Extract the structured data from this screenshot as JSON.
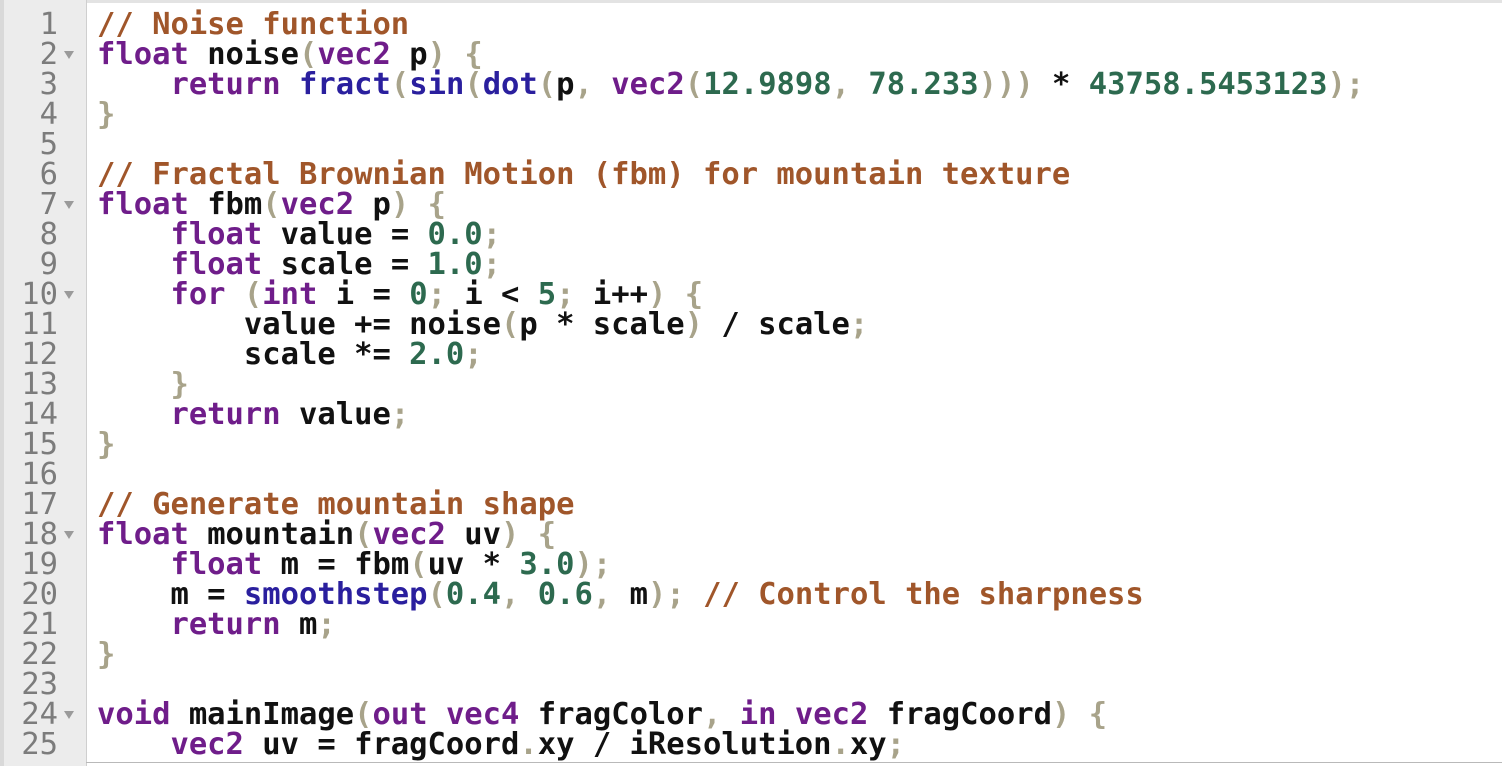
{
  "editor": {
    "language": "glsl",
    "lines": [
      {
        "n": "1",
        "fold": false,
        "tokens": [
          [
            "cm",
            "// Noise function"
          ]
        ]
      },
      {
        "n": "2",
        "fold": true,
        "tokens": [
          [
            "kw",
            "float"
          ],
          [
            "id",
            " noise"
          ],
          [
            "pu",
            "("
          ],
          [
            "kw",
            "vec2"
          ],
          [
            "id",
            " p"
          ],
          [
            "pu",
            ")"
          ],
          [
            "id",
            " "
          ],
          [
            "pu",
            "{"
          ]
        ]
      },
      {
        "n": "3",
        "fold": false,
        "tokens": [
          [
            "id",
            "    "
          ],
          [
            "kw",
            "return"
          ],
          [
            "id",
            " "
          ],
          [
            "fn",
            "fract"
          ],
          [
            "pu",
            "("
          ],
          [
            "fn",
            "sin"
          ],
          [
            "pu",
            "("
          ],
          [
            "fn",
            "dot"
          ],
          [
            "pu",
            "("
          ],
          [
            "id",
            "p"
          ],
          [
            "pu",
            ","
          ],
          [
            "id",
            " "
          ],
          [
            "kw",
            "vec2"
          ],
          [
            "pu",
            "("
          ],
          [
            "num",
            "12.9898"
          ],
          [
            "pu",
            ","
          ],
          [
            "id",
            " "
          ],
          [
            "num",
            "78.233"
          ],
          [
            "pu",
            ")))"
          ],
          [
            "id",
            " * "
          ],
          [
            "num",
            "43758.5453123"
          ],
          [
            "pu",
            ");"
          ]
        ]
      },
      {
        "n": "4",
        "fold": false,
        "tokens": [
          [
            "pu",
            "}"
          ]
        ]
      },
      {
        "n": "5",
        "fold": false,
        "tokens": []
      },
      {
        "n": "6",
        "fold": false,
        "tokens": [
          [
            "cm",
            "// Fractal Brownian Motion (fbm) for mountain texture"
          ]
        ]
      },
      {
        "n": "7",
        "fold": true,
        "tokens": [
          [
            "kw",
            "float"
          ],
          [
            "id",
            " fbm"
          ],
          [
            "pu",
            "("
          ],
          [
            "kw",
            "vec2"
          ],
          [
            "id",
            " p"
          ],
          [
            "pu",
            ")"
          ],
          [
            "id",
            " "
          ],
          [
            "pu",
            "{"
          ]
        ]
      },
      {
        "n": "8",
        "fold": false,
        "tokens": [
          [
            "id",
            "    "
          ],
          [
            "kw",
            "float"
          ],
          [
            "id",
            " value = "
          ],
          [
            "num",
            "0.0"
          ],
          [
            "pu",
            ";"
          ]
        ]
      },
      {
        "n": "9",
        "fold": false,
        "tokens": [
          [
            "id",
            "    "
          ],
          [
            "kw",
            "float"
          ],
          [
            "id",
            " scale = "
          ],
          [
            "num",
            "1.0"
          ],
          [
            "pu",
            ";"
          ]
        ]
      },
      {
        "n": "10",
        "fold": true,
        "tokens": [
          [
            "id",
            "    "
          ],
          [
            "kw",
            "for"
          ],
          [
            "id",
            " "
          ],
          [
            "pu",
            "("
          ],
          [
            "kw",
            "int"
          ],
          [
            "id",
            " i = "
          ],
          [
            "num",
            "0"
          ],
          [
            "pu",
            ";"
          ],
          [
            "id",
            " i < "
          ],
          [
            "num",
            "5"
          ],
          [
            "pu",
            ";"
          ],
          [
            "id",
            " i++"
          ],
          [
            "pu",
            ")"
          ],
          [
            "id",
            " "
          ],
          [
            "pu",
            "{"
          ]
        ]
      },
      {
        "n": "11",
        "fold": false,
        "tokens": [
          [
            "id",
            "        value += noise"
          ],
          [
            "pu",
            "("
          ],
          [
            "id",
            "p * scale"
          ],
          [
            "pu",
            ")"
          ],
          [
            "id",
            " / scale"
          ],
          [
            "pu",
            ";"
          ]
        ]
      },
      {
        "n": "12",
        "fold": false,
        "tokens": [
          [
            "id",
            "        scale *= "
          ],
          [
            "num",
            "2.0"
          ],
          [
            "pu",
            ";"
          ]
        ]
      },
      {
        "n": "13",
        "fold": false,
        "tokens": [
          [
            "id",
            "    "
          ],
          [
            "pu",
            "}"
          ]
        ]
      },
      {
        "n": "14",
        "fold": false,
        "tokens": [
          [
            "id",
            "    "
          ],
          [
            "kw",
            "return"
          ],
          [
            "id",
            " value"
          ],
          [
            "pu",
            ";"
          ]
        ]
      },
      {
        "n": "15",
        "fold": false,
        "tokens": [
          [
            "pu",
            "}"
          ]
        ]
      },
      {
        "n": "16",
        "fold": false,
        "tokens": []
      },
      {
        "n": "17",
        "fold": false,
        "tokens": [
          [
            "cm",
            "// Generate mountain shape"
          ]
        ]
      },
      {
        "n": "18",
        "fold": true,
        "tokens": [
          [
            "kw",
            "float"
          ],
          [
            "id",
            " mountain"
          ],
          [
            "pu",
            "("
          ],
          [
            "kw",
            "vec2"
          ],
          [
            "id",
            " uv"
          ],
          [
            "pu",
            ")"
          ],
          [
            "id",
            " "
          ],
          [
            "pu",
            "{"
          ]
        ]
      },
      {
        "n": "19",
        "fold": false,
        "tokens": [
          [
            "id",
            "    "
          ],
          [
            "kw",
            "float"
          ],
          [
            "id",
            " m = fbm"
          ],
          [
            "pu",
            "("
          ],
          [
            "id",
            "uv * "
          ],
          [
            "num",
            "3.0"
          ],
          [
            "pu",
            ");"
          ]
        ]
      },
      {
        "n": "20",
        "fold": false,
        "tokens": [
          [
            "id",
            "    m = "
          ],
          [
            "fn",
            "smoothstep"
          ],
          [
            "pu",
            "("
          ],
          [
            "num",
            "0.4"
          ],
          [
            "pu",
            ","
          ],
          [
            "id",
            " "
          ],
          [
            "num",
            "0.6"
          ],
          [
            "pu",
            ","
          ],
          [
            "id",
            " m"
          ],
          [
            "pu",
            ");"
          ],
          [
            "id",
            " "
          ],
          [
            "cm",
            "// Control the sharpness"
          ]
        ]
      },
      {
        "n": "21",
        "fold": false,
        "tokens": [
          [
            "id",
            "    "
          ],
          [
            "kw",
            "return"
          ],
          [
            "id",
            " m"
          ],
          [
            "pu",
            ";"
          ]
        ]
      },
      {
        "n": "22",
        "fold": false,
        "tokens": [
          [
            "pu",
            "}"
          ]
        ]
      },
      {
        "n": "23",
        "fold": false,
        "tokens": []
      },
      {
        "n": "24",
        "fold": true,
        "tokens": [
          [
            "kw",
            "void"
          ],
          [
            "id",
            " mainImage"
          ],
          [
            "pu",
            "("
          ],
          [
            "kw",
            "out"
          ],
          [
            "id",
            " "
          ],
          [
            "kw",
            "vec4"
          ],
          [
            "id",
            " fragColor"
          ],
          [
            "pu",
            ","
          ],
          [
            "id",
            " "
          ],
          [
            "kw",
            "in"
          ],
          [
            "id",
            " "
          ],
          [
            "kw",
            "vec2"
          ],
          [
            "id",
            " fragCoord"
          ],
          [
            "pu",
            ")"
          ],
          [
            "id",
            " "
          ],
          [
            "pu",
            "{"
          ]
        ]
      },
      {
        "n": "25",
        "fold": false,
        "tokens": [
          [
            "id",
            "    "
          ],
          [
            "kw",
            "vec2"
          ],
          [
            "id",
            " uv = fragCoord"
          ],
          [
            "pu",
            "."
          ],
          [
            "id",
            "xy / iResolution"
          ],
          [
            "pu",
            "."
          ],
          [
            "id",
            "xy"
          ],
          [
            "pu",
            ";"
          ]
        ]
      }
    ]
  },
  "colors": {
    "comment": "#a0562a",
    "keyword": "#6f1d8a",
    "builtin": "#2a1f9e",
    "number": "#2d6a4f",
    "punctuation": "#a8a38a",
    "identifier": "#111111",
    "gutter_bg": "#ececec",
    "line_number": "#7c7c7c"
  },
  "icons": {
    "fold_marker": "chevron-down-icon"
  }
}
